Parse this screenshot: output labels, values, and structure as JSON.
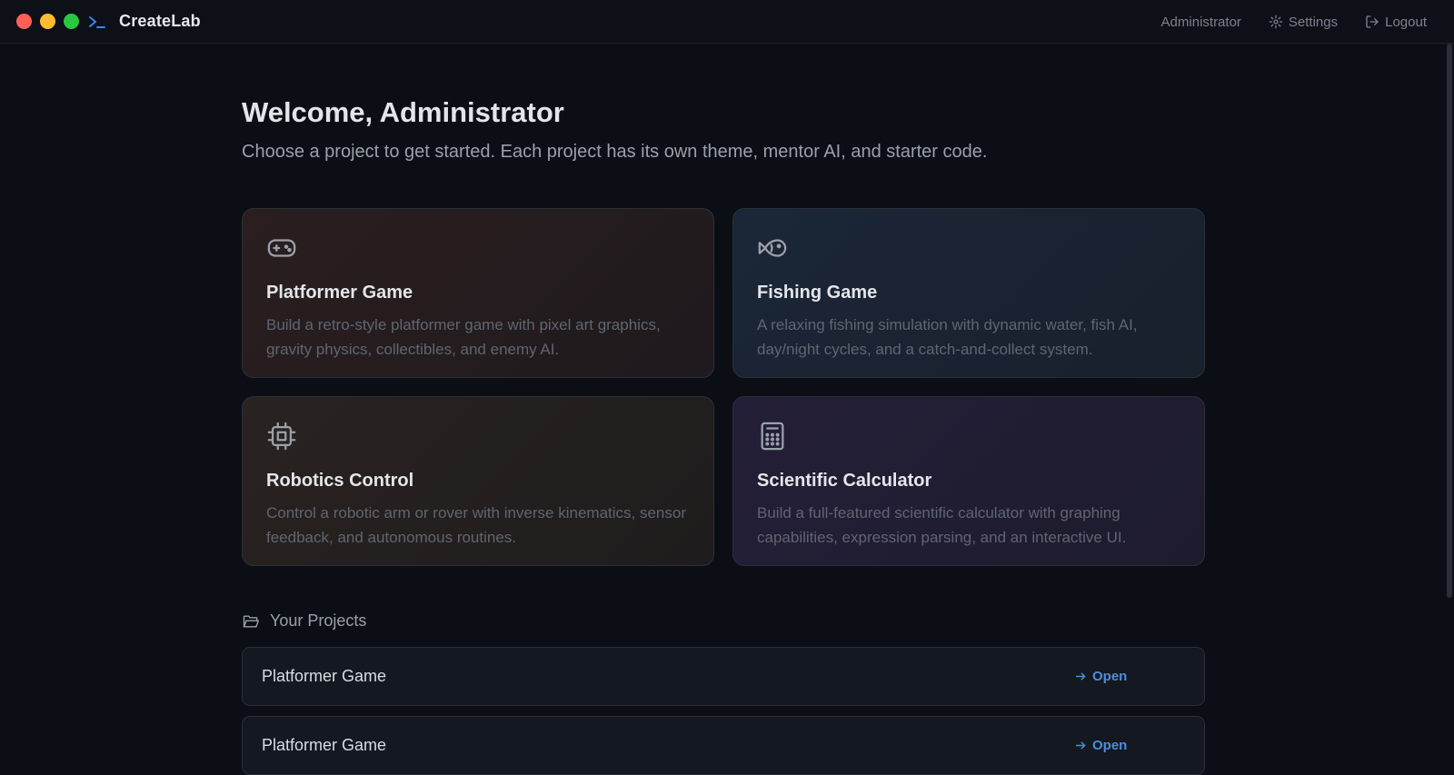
{
  "app": {
    "name": "CreateLab"
  },
  "topnav": {
    "user": "Administrator",
    "settings_label": "Settings",
    "logout_label": "Logout"
  },
  "main": {
    "welcome": "Welcome, Administrator",
    "subtitle": "Choose a project to get started. Each project has its own theme, mentor AI, and starter code."
  },
  "templates": [
    {
      "icon": "gamepad-icon",
      "title": "Platformer Game",
      "desc": "Build a retro-style platformer game with pixel art graphics, gravity physics, collectibles, and enemy AI."
    },
    {
      "icon": "fish-icon",
      "title": "Fishing Game",
      "desc": "A relaxing fishing simulation with dynamic water, fish AI, day/night cycles, and a catch-and-collect system."
    },
    {
      "icon": "cpu-icon",
      "title": "Robotics Control",
      "desc": "Control a robotic arm or rover with inverse kinematics, sensor feedback, and autonomous routines."
    },
    {
      "icon": "calculator-icon",
      "title": "Scientific Calculator",
      "desc": "Build a full-featured scientific calculator with graphing capabilities, expression parsing, and an interactive UI."
    }
  ],
  "projects": {
    "heading": "Your Projects",
    "items": [
      {
        "name": "Platformer Game",
        "action": "Open"
      },
      {
        "name": "Platformer Game",
        "action": "Open"
      }
    ]
  },
  "colors": {
    "background": "#0b0e14",
    "accent": "#4a8ee0",
    "terminal_icon": "#3b82f6"
  }
}
